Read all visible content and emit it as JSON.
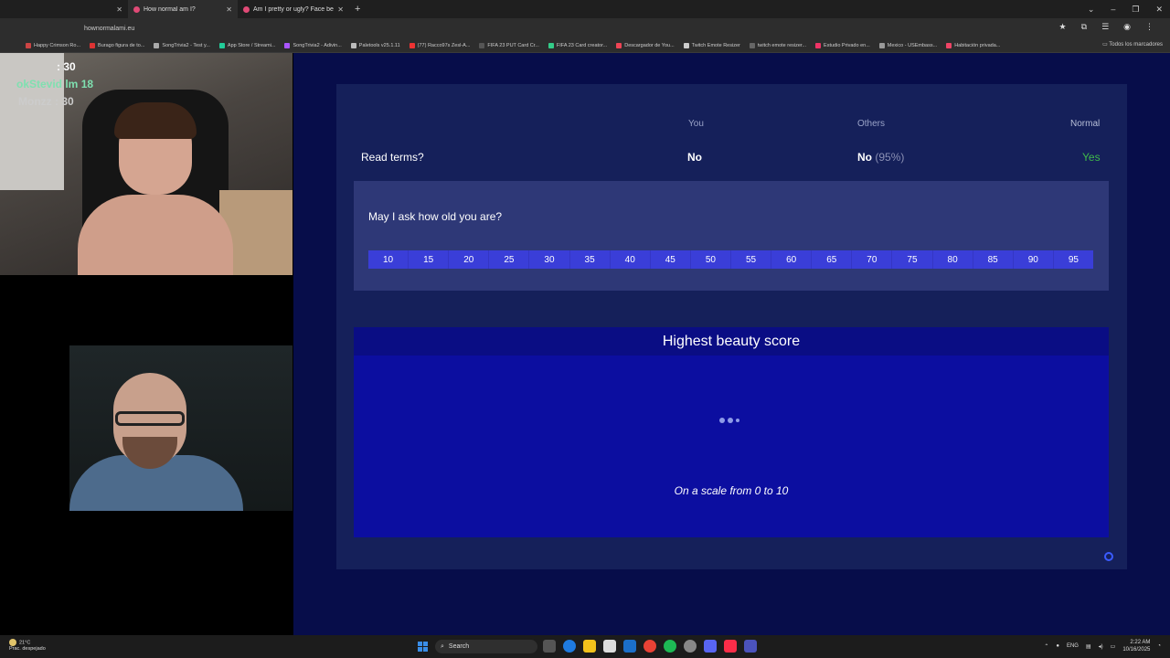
{
  "browser": {
    "tabs": [
      {
        "label": "How normal am I?",
        "active": true
      },
      {
        "label": "Am I pretty or ugly? Face beau",
        "active": false
      }
    ],
    "new_tab": "+",
    "url": "hownormalami.eu",
    "bookmarks": [
      "Happy Crimson Ro...",
      "Burago figura de to...",
      "SongTrivia2 - Test y...",
      "App Store / Streami...",
      "SongTrivia2 - Adivin...",
      "Paletools v25.1.11",
      "(77) Racco97s Zesl-A...",
      "FIFA 23 PUT Card Cr...",
      "FIFA 23 Card creator...",
      "Descargador de You...",
      "Twitch Emote Resizer",
      "twitch emote resizer...",
      "Estudio Privado en...",
      "Mexico - USEmbass...",
      "Habitación privada..."
    ],
    "bookmarks_folder": "Todos los marcadores"
  },
  "stream": {
    "overlay_line1": ": 30",
    "overlay_line2": "okStevid  lm 18",
    "overlay_line3": "Monzz : 30"
  },
  "page": {
    "headers": {
      "you": "You",
      "others": "Others",
      "normal": "Normal"
    },
    "row": {
      "question": "Read terms?",
      "you": "No",
      "others_answer": "No",
      "others_pct": "(95%)",
      "normal": "Yes"
    },
    "age": {
      "question": "May I ask how old you are?",
      "options": [
        "10",
        "15",
        "20",
        "25",
        "30",
        "35",
        "40",
        "45",
        "50",
        "55",
        "60",
        "65",
        "70",
        "75",
        "80",
        "85",
        "90",
        "95"
      ]
    },
    "beauty": {
      "title": "Highest beauty score",
      "caption": "On a scale from 0 to 10"
    }
  },
  "taskbar": {
    "weather_temp": "21°C",
    "weather_desc": "Prac. despejado",
    "search_label": "Search",
    "lang": "ENG",
    "time": "2:22 AM",
    "date": "10/16/2025"
  },
  "colors": {
    "page_bg": "#070d4a",
    "card_bg": "#15205a",
    "accent_blue": "#3a3ed8",
    "beauty_bg": "#0c0ea0",
    "normal_green": "#3fb94a"
  }
}
